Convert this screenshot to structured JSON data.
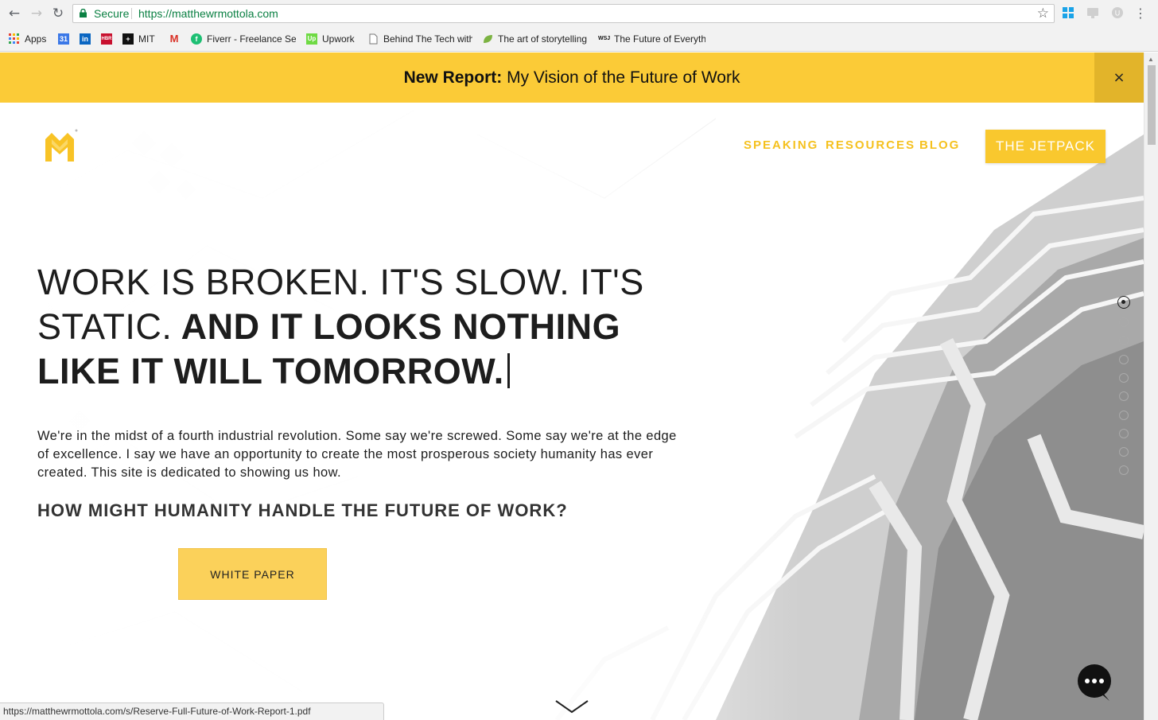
{
  "browser": {
    "back_icon": "back-arrow-icon",
    "forward_icon": "forward-arrow-icon",
    "reload_icon": "reload-icon",
    "secure_label": "Secure",
    "url": "https://matthewrmottola.com",
    "star_icon": "bookmark-star-icon",
    "menu_icon": "kebab-menu-icon"
  },
  "bookmarks": [
    {
      "label": "Apps",
      "icon": "apps-grid-icon"
    },
    {
      "label": "",
      "icon": "calendar-icon"
    },
    {
      "label": "",
      "icon": "linkedin-icon"
    },
    {
      "label": "",
      "icon": "hbr-icon"
    },
    {
      "label": "MIT",
      "icon": "mit-icon"
    },
    {
      "label": "",
      "icon": "gmail-icon"
    },
    {
      "label": "Fiverr - Freelance Ser",
      "icon": "fiverr-icon"
    },
    {
      "label": "Upwork",
      "icon": "upwork-icon"
    },
    {
      "label": "Behind The Tech with",
      "icon": "document-icon"
    },
    {
      "label": "The art of storytelling",
      "icon": "leaf-icon"
    },
    {
      "label": "The Future of Everyth",
      "icon": "wsj-icon"
    }
  ],
  "banner": {
    "bold": "New Report:",
    "text": "My Vision of the Future of Work",
    "close": "×"
  },
  "nav": {
    "speaking": "SPEAKING",
    "resources": "RESOURCES",
    "blog": "BLOG",
    "cta": "THE JETPACK"
  },
  "hero": {
    "headline_light": "WORK IS BROKEN. IT'S SLOW. IT'S STATIC.",
    "headline_bold": "AND IT LOOKS NOTHING LIKE IT WILL TOMORROW.",
    "intro": "We're in the midst of a fourth industrial revolution. Some say we're screwed. Some say we're at the edge of excellence. I say we have an opportunity to create the most prosperous society humanity has ever created. This site is dedicated to showing us how.",
    "subhead": "HOW MIGHT HUMANITY HANDLE THE FUTURE OF WORK?",
    "button": "WHITE PAPER"
  },
  "section_dots": {
    "count": 10,
    "active_index": 0
  },
  "status_bar": "https://matthewrmottola.com/s/Reserve-Full-Future-of-Work-Report-1.pdf",
  "colors": {
    "accent": "#fbcb37",
    "text": "#1d1d1d",
    "secure": "#0b8043"
  }
}
